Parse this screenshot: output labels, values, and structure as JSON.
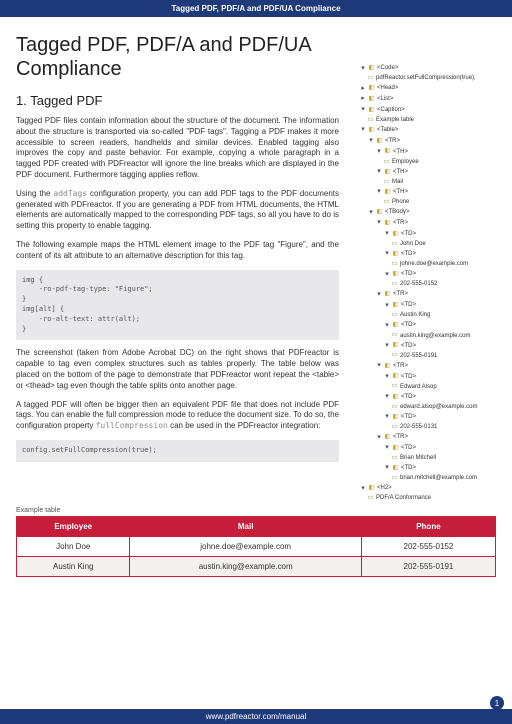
{
  "header": "Tagged PDF, PDF/A and PDF/UA Compliance",
  "title": "Tagged PDF, PDF/A and PDF/UA Compliance",
  "section_heading": "1. Tagged PDF",
  "para1": "Tagged PDF files contain information about the structure of the document. The information about the structure is transported via so-called \"PDF tags\". Tagging a PDF makes it more accessible to screen readers, handhelds and similar devices. Enabled tagging also improves the copy and paste behavior. For example, copying a whole paragraph in a tagged PDF created with PDFreactor will ignore the line breaks which are displayed in the PDF document. Furthermore tagging applies reflow.",
  "para2a": "Using the ",
  "para2_code": "addTags",
  "para2b": " configuration property, you can add PDF tags to the PDF documents generated with PDFreactor. If you are generating a PDF from HTML documents, the HTML elements are automatically mapped to the corresponding PDF tags, so all you have to do is setting this property to enable tagging.",
  "para3": "The following example maps the HTML element image to the PDF tag \"Figure\", and the content of its alt attribute to an alternative description for this tag.",
  "code1": "img {\n    -ro-pdf-tag-type: \"Figure\";\n}\nimg[alt] {\n    -ro-alt-text: attr(alt);\n}",
  "para4": "The screenshot (taken from Adobe Acrobat DC) on the right shows that PDFreactor is capable to tag even complex structures such as tables properly. The table below was placed on the bottom of the page to demonstrate that PDFreactor wont repeat the <table> or <thead> tag even though the table splits onto another page.",
  "para5a": "A tagged PDF will often be bigger then an equivalent PDF file that does not include PDF tags. You can enable the full compression mode to reduce the document size. To do so, the configuration property ",
  "para5_code": "fullCompression",
  "para5b": " can be used in the PDFreactor integration:",
  "code2": "config.setFullCompression(true);",
  "tree": {
    "root": "<Code>",
    "pdfreactor": "pdfReactor.setFullCompression(true);",
    "head": "<Head>",
    "list": "<List>",
    "caption": "<Caption>",
    "example_table": "Example table",
    "table": "<Table>",
    "tr": "<TR>",
    "th": "<TH>",
    "td": "<TD>",
    "tbody": "<TBody>",
    "employee": "Employee",
    "mail": "Mail",
    "phone": "Phone",
    "john_doe": "John Doe",
    "john_email": "johne.doe@example.com",
    "john_phone": "202-555-0152",
    "austin": "Austin King",
    "austin_email": "austin.king@example.com",
    "austin_phone": "202-555-0191",
    "edward": "Edward Alsop",
    "edward_email": "edward.alsop@example.com",
    "edward_phone": "202-555-0131",
    "brian": "Brian Mitchell",
    "brian_email": "brian.mitchell@example.com",
    "h2": "<H2>",
    "pdfa": "PDF/A Conformance"
  },
  "table_caption": "Example table",
  "table_headers": {
    "employee": "Employee",
    "mail": "Mail",
    "phone": "Phone"
  },
  "table_rows": [
    {
      "employee": "John Doe",
      "mail": "johne.doe@example.com",
      "phone": "202-555-0152"
    },
    {
      "employee": "Austin King",
      "mail": "austin.king@example.com",
      "phone": "202-555-0191"
    }
  ],
  "footer_url": "www.pdfreactor.com/manual",
  "page_num": "1"
}
